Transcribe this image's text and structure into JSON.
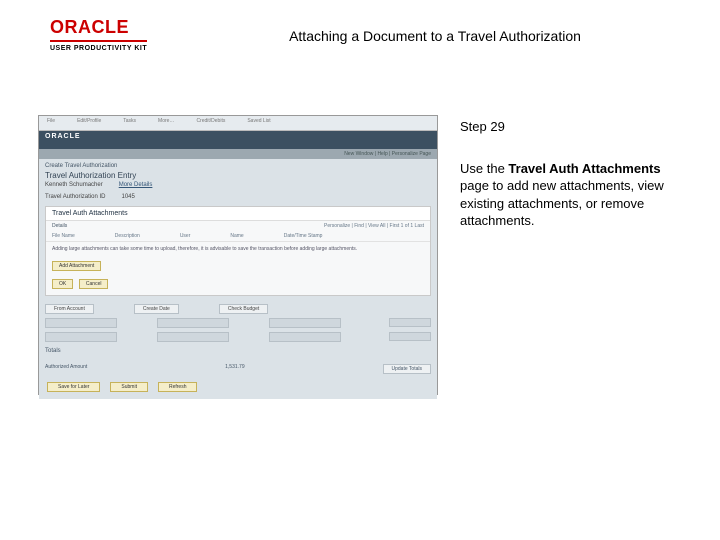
{
  "header": {
    "brand": "ORACLE",
    "brand_sub": "USER PRODUCTIVITY KIT",
    "title": "Attaching a Document to a Travel Authorization"
  },
  "side": {
    "step_label": "Step 29",
    "para_pre": "Use the ",
    "para_bold": "Travel Auth Attachments",
    "para_post": " page to add new attachments, view existing attachments, or remove attachments."
  },
  "shot": {
    "tabs": [
      "File",
      "Edit/Profile",
      "Tasks",
      "More…",
      "Credit/Debits",
      "Saved List"
    ],
    "brand": "ORACLE",
    "crumbs": "New Window | Help | Personalize Page",
    "line1": "Create Travel Authorization",
    "line2": "Travel Authorization Entry",
    "name": "Kenneth Schumacher",
    "doc": "More Details",
    "auth_id_label": "Travel Authorization ID",
    "auth_id_value": "1045",
    "panel_title": "Travel Auth Attachments",
    "panel_bar_left": "Details",
    "panel_bar_right": "Personalize | Find | View All | First 1 of 1 Last",
    "col1": "File Name",
    "col2": "Description",
    "col3": "User",
    "col4": "Name",
    "col5": "Date/Time Stamp",
    "note": "Adding large attachments can take some time to upload, therefore, it is advisable to save the transaction before adding large attachments.",
    "btn_add": "Add Attachment",
    "btn_ok": "OK",
    "btn_cancel": "Cancel",
    "grid_h1": "From Account",
    "grid_h2": "Create Date",
    "grid_h3": "Check Budget",
    "row_label": "Totals",
    "sum_label": "Authorized Amount",
    "sum_val": "1,531.79",
    "sum_btn": "Update Totals",
    "f1": "Save for Later",
    "f2": "Submit",
    "f3": "Refresh"
  }
}
